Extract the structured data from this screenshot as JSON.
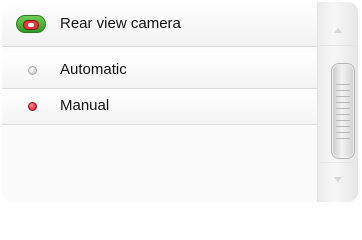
{
  "menu": {
    "title": "Rear view camera",
    "options": [
      {
        "label": "Automatic",
        "selected": false
      },
      {
        "label": "Manual",
        "selected": true
      }
    ]
  },
  "icons": {
    "title_icon": "rear-camera-icon",
    "option_off": "radio-unselected-icon",
    "option_on": "radio-selected-icon",
    "scroll_up": "chevron-up-icon",
    "scroll_down": "chevron-down-icon"
  },
  "colors": {
    "selected_radio": "#c8102e",
    "camera_badge_green": "#3aa82a",
    "camera_body_red": "#e43a3a"
  }
}
